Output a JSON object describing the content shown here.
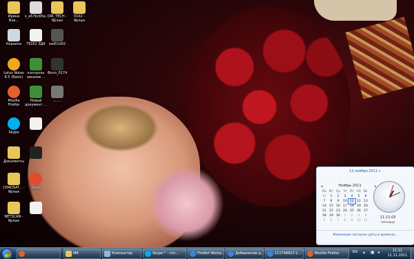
{
  "desktop": {
    "icons": [
      {
        "label": "Ирина Вла...",
        "icon": "user-folder-icon",
        "color": "#e8c65a"
      },
      {
        "label": "s_a57bc65a...",
        "icon": "image-file-icon",
        "color": "#dddddd"
      },
      {
        "label": "DIR_TECH - Ярлык",
        "icon": "folder-shortcut-icon",
        "color": "#e8c65a"
      },
      {
        "label": "0102 - Ярлык",
        "icon": "folder-shortcut-icon",
        "color": "#e8c65a"
      },
      {
        "label": "Корзина",
        "icon": "recycle-bin-icon",
        "color": "#cfd8e0"
      },
      {
        "label": "TELE2 3ДА",
        "icon": "document-icon",
        "color": "#f2f2f2"
      },
      {
        "label": "ssd51d02",
        "icon": "image-file-icon",
        "color": "#555555"
      },
      {
        "label": "Lotus Notes 8.5 (Basic)",
        "icon": "lotus-notes-icon",
        "color": "#f2a81d"
      },
      {
        "label": "контроль заказов ...",
        "icon": "spreadsheet-icon",
        "color": "#3f8f3a"
      },
      {
        "label": "Фото_0174",
        "icon": "image-file-icon",
        "color": "#333333"
      },
      {
        "label": "Mozilla Firefox",
        "icon": "firefox-icon",
        "color": "#e0622a"
      },
      {
        "label": "Новый документ ...",
        "icon": "spreadsheet-icon",
        "color": "#3f8f3a"
      },
      {
        "label": "........",
        "icon": "image-file-icon",
        "color": "#777777"
      },
      {
        "label": "Skype",
        "icon": "skype-icon",
        "color": "#00aff0"
      },
      {
        "label": "",
        "icon": "document-icon",
        "color": "#f2f2f2"
      },
      {
        "label": "Документы",
        "icon": "documents-folder-icon",
        "color": "#e8c65a"
      },
      {
        "label": "",
        "icon": "image-file-icon",
        "color": "#222222"
      },
      {
        "label": "CHAOSAT... - Ярлык",
        "icon": "folder-shortcut-icon",
        "color": "#e8c65a"
      },
      {
        "label": "Хром",
        "icon": "chrome-icon",
        "color": "#e24a2e"
      },
      {
        "label": "NETSCAN - Ярлык",
        "icon": "folder-shortcut-icon",
        "color": "#e8c65a"
      },
      {
        "label": "",
        "icon": "document-icon",
        "color": "#f2f2f2"
      }
    ]
  },
  "calendar": {
    "header_date": "11 ноября 2011 г.",
    "prev_arrow": "◂",
    "next_arrow": "▸",
    "month_title": "Ноябрь 2011",
    "weekdays": [
      "Пн",
      "Вт",
      "Ср",
      "Чт",
      "Пт",
      "Сб",
      "Вс"
    ],
    "weeks": [
      [
        "31",
        "1",
        "2",
        "3",
        "4",
        "5",
        "6"
      ],
      [
        "7",
        "8",
        "9",
        "10",
        "11",
        "12",
        "13"
      ],
      [
        "14",
        "15",
        "16",
        "17",
        "18",
        "19",
        "20"
      ],
      [
        "21",
        "22",
        "23",
        "24",
        "25",
        "26",
        "27"
      ],
      [
        "28",
        "29",
        "30",
        "1",
        "2",
        "3",
        "4"
      ],
      [
        "5",
        "6",
        "7",
        "8",
        "9",
        "10",
        "11"
      ]
    ],
    "today": "11",
    "time": "11:11:03",
    "weekday_name": "пятница",
    "settings_link": "Изменение настроек даты и времени..."
  },
  "taskbar": {
    "buttons": [
      {
        "label": "",
        "icon": "firefox-icon",
        "color": "#e0622a"
      },
      {
        "label": "МК",
        "icon": "folder-icon",
        "color": "#e8c65a"
      },
      {
        "label": "Компьютер",
        "icon": "computer-icon",
        "color": "#8fb7de"
      },
      {
        "label": "Skype™ - irin...",
        "icon": "skype-icon",
        "color": "#00aff0"
      },
      {
        "label": "FireNet Workp...",
        "icon": "ie-icon",
        "color": "#3a86d4"
      },
      {
        "label": "Добавление д...",
        "icon": "ie-icon",
        "color": "#3a86d4"
      },
      {
        "label": "111748822-1...",
        "icon": "ie-icon",
        "color": "#3a86d4"
      },
      {
        "label": "Mozilla Firefox",
        "icon": "firefox-icon",
        "color": "#e0622a"
      }
    ],
    "language": "EN",
    "clock_time": "11:11",
    "clock_date": "11.11.2011"
  }
}
